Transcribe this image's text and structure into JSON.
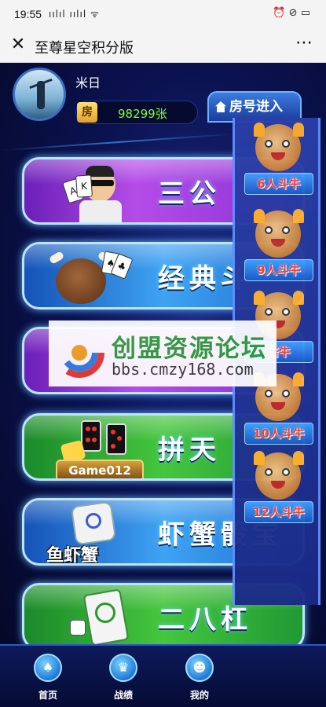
{
  "status": {
    "time": "19:55",
    "signal": "ıılıl ıılıl ᯤ",
    "right": "⏰ ⊘ ▭"
  },
  "nav": {
    "close_icon": "close-icon",
    "title": "至尊星空积分版",
    "more": "⋯"
  },
  "user": {
    "name": "米日",
    "coin_label": "房",
    "coins": "98299张"
  },
  "room_tab": {
    "label": "房号进入"
  },
  "games": [
    {
      "label": "三公",
      "color": "purple"
    },
    {
      "label": "经典斗",
      "color": "blue"
    },
    {
      "label": "",
      "color": "purple"
    },
    {
      "label": "拼天",
      "color": "green",
      "logo": "Game012"
    },
    {
      "label": "虾蟹骰宝",
      "color": "blue",
      "logo_text": "鱼虾蟹"
    },
    {
      "label": "二八杠",
      "color": "green"
    }
  ],
  "rooms": [
    {
      "label": "6人斗牛"
    },
    {
      "label": "9人斗牛"
    },
    {
      "label": "倍牛"
    },
    {
      "label": "10人斗牛"
    },
    {
      "label": "12人斗牛"
    }
  ],
  "watermark": {
    "title": "创盟资源论坛",
    "url": "bbs.cmzy168.com"
  },
  "tabs": [
    {
      "label": "首页",
      "icon": "spade-icon",
      "glyph": "♠"
    },
    {
      "label": "战绩",
      "icon": "trophy-icon",
      "glyph": "♛"
    },
    {
      "label": "我的",
      "icon": "user-icon",
      "glyph": "☻"
    }
  ]
}
